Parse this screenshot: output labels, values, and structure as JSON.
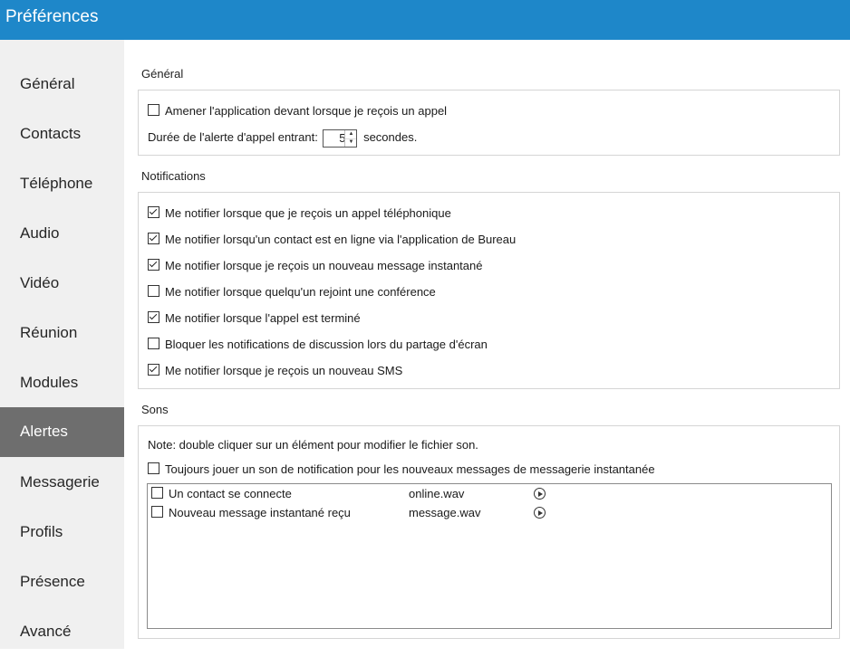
{
  "window": {
    "title": "Préférences"
  },
  "sidebar": {
    "items": [
      {
        "label": "Général"
      },
      {
        "label": "Contacts"
      },
      {
        "label": "Téléphone"
      },
      {
        "label": "Audio"
      },
      {
        "label": "Vidéo"
      },
      {
        "label": "Réunion"
      },
      {
        "label": "Modules"
      },
      {
        "label": "Alertes",
        "active": true
      },
      {
        "label": "Messagerie"
      },
      {
        "label": "Profils"
      },
      {
        "label": "Présence"
      },
      {
        "label": "Avancé"
      }
    ]
  },
  "general": {
    "heading": "Général",
    "bring_to_front": {
      "label": "Amener l'application devant lorsque je reçois un appel",
      "checked": false
    },
    "alert_duration": {
      "label": "Durée de l'alerte d'appel entrant:",
      "value": "5",
      "unit": "secondes."
    }
  },
  "notifications": {
    "heading": "Notifications",
    "items": [
      {
        "label": "Me notifier lorsque que je reçois un appel téléphonique",
        "checked": true
      },
      {
        "label": "Me notifier lorsqu'un contact est en ligne via l'application de Bureau",
        "checked": true
      },
      {
        "label": "Me notifier lorsque je reçois un nouveau message instantané",
        "checked": true
      },
      {
        "label": "Me notifier lorsque quelqu'un rejoint une conférence",
        "checked": false
      },
      {
        "label": "Me notifier lorsque l'appel est terminé",
        "checked": true
      },
      {
        "label": "Bloquer les notifications de discussion lors du partage d'écran",
        "checked": false
      },
      {
        "label": "Me notifier lorsque je reçois un nouveau SMS",
        "checked": true
      }
    ]
  },
  "sounds": {
    "heading": "Sons",
    "note": "Note: double cliquer sur un élément pour modifier le fichier son.",
    "always_play": {
      "label": "Toujours jouer un son de notification pour les nouveaux messages de messagerie instantanée",
      "checked": false
    },
    "list": [
      {
        "name": "Un contact se connecte",
        "file": "online.wav",
        "checked": false
      },
      {
        "name": "Nouveau message instantané reçu",
        "file": "message.wav",
        "checked": false
      }
    ]
  }
}
